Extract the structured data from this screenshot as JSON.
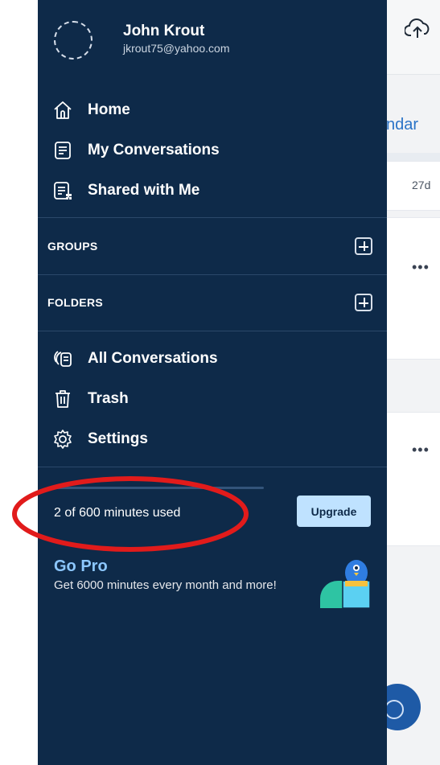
{
  "background": {
    "tab_partial": "ndar",
    "card_days": "27d",
    "more_label": "•••"
  },
  "drawer": {
    "profile": {
      "name": "John Krout",
      "email": "jkrout75@yahoo.com"
    },
    "nav_top": [
      {
        "label": "Home",
        "icon": "home-icon"
      },
      {
        "label": "My Conversations",
        "icon": "document-icon"
      },
      {
        "label": "Shared with Me",
        "icon": "shared-document-icon"
      }
    ],
    "sections": {
      "groups": "GROUPS",
      "folders": "FOLDERS"
    },
    "nav_bottom": [
      {
        "label": "All Conversations",
        "icon": "stacked-documents-icon"
      },
      {
        "label": "Trash",
        "icon": "trash-icon"
      },
      {
        "label": "Settings",
        "icon": "gear-icon"
      }
    ],
    "usage": {
      "text": "2 of 600 minutes used",
      "used_fraction": 0.0033,
      "upgrade_label": "Upgrade"
    },
    "promo": {
      "title": "Go Pro",
      "description": "Get 6000 minutes every month and more!"
    }
  },
  "colors": {
    "drawer_bg": "#0e2a49",
    "accent": "#8cc7ff",
    "upgrade_bg": "#bfe2ff",
    "annotation": "#e11b1b"
  }
}
